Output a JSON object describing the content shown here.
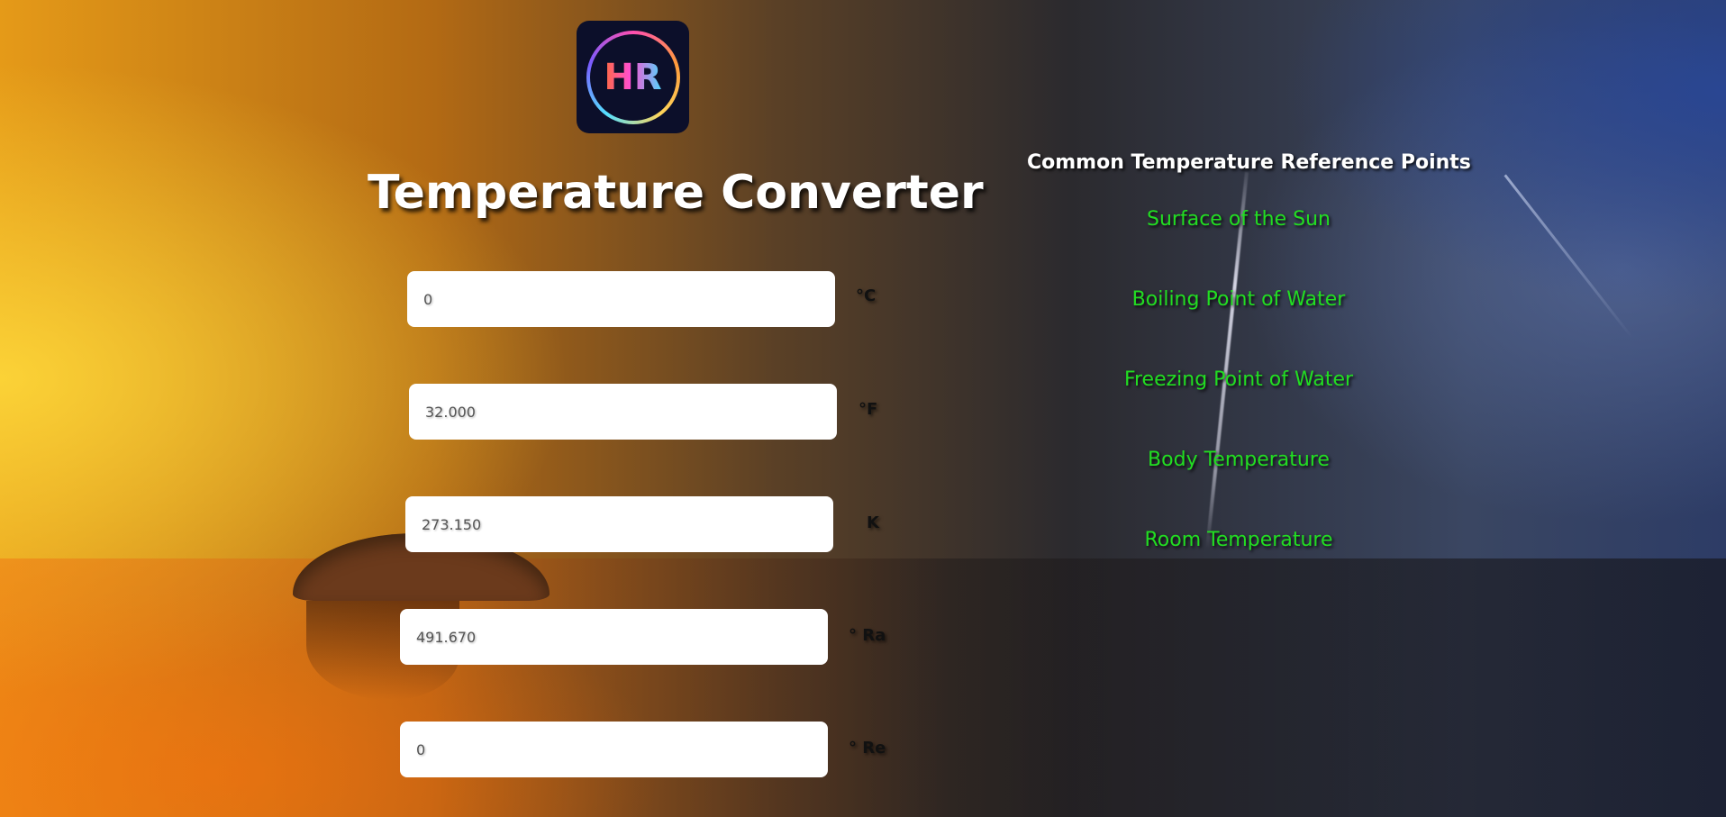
{
  "logo": {
    "text": "HR"
  },
  "title": "Temperature Converter",
  "fields": [
    {
      "value": "0",
      "unit": "°C"
    },
    {
      "value": "32.000",
      "unit": "°F"
    },
    {
      "value": "273.150",
      "unit": "K"
    },
    {
      "value": "491.670",
      "unit": "° Ra"
    },
    {
      "value": "0",
      "unit": "° Re"
    }
  ],
  "references": {
    "title": "Common Temperature Reference Points",
    "items": [
      "Surface of the Sun",
      "Boiling Point of Water",
      "Freezing Point of Water",
      "Body Temperature",
      "Room Temperature"
    ],
    "link_color": "#22dd22"
  }
}
